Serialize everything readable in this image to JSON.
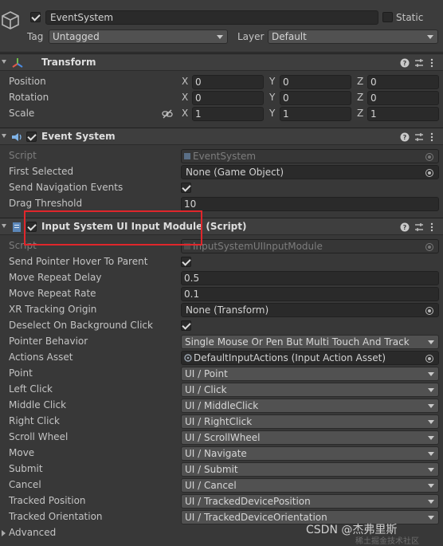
{
  "header": {
    "active": true,
    "name": "EventSystem",
    "static_label": "Static",
    "tag_label": "Tag",
    "tag_value": "Untagged",
    "layer_label": "Layer",
    "layer_value": "Default"
  },
  "transform": {
    "title": "Transform",
    "rows": [
      {
        "label": "Position",
        "x": "0",
        "y": "0",
        "z": "0"
      },
      {
        "label": "Rotation",
        "x": "0",
        "y": "0",
        "z": "0"
      },
      {
        "label": "Scale",
        "x": "1",
        "y": "1",
        "z": "1"
      }
    ],
    "axis_x": "X",
    "axis_y": "Y",
    "axis_z": "Z"
  },
  "event_system": {
    "title": "Event System",
    "enabled": true,
    "script_label": "Script",
    "script_value": "EventSystem",
    "first_selected_label": "First Selected",
    "first_selected_value": "None (Game Object)",
    "send_nav_label": "Send Navigation Events",
    "send_nav_checked": true,
    "drag_threshold_label": "Drag Threshold",
    "drag_threshold_value": "10"
  },
  "input_module": {
    "title": "Input System UI Input Module (Script)",
    "enabled": true,
    "script_label": "Script",
    "script_value": "InputSystemUIInputModule",
    "send_hover_label": "Send Pointer Hover To Parent",
    "move_delay_label": "Move Repeat Delay",
    "move_delay_value": "0.5",
    "move_rate_label": "Move Repeat Rate",
    "move_rate_value": "0.1",
    "xr_label": "XR Tracking Origin",
    "xr_value": "None (Transform)",
    "deselect_label": "Deselect On Background Click",
    "pointer_behavior_label": "Pointer Behavior",
    "pointer_behavior_value": "Single Mouse Or Pen But Multi Touch And Track",
    "actions_asset_label": "Actions Asset",
    "actions_asset_value": "DefaultInputActions (Input Action Asset)",
    "actions": [
      {
        "label": "Point",
        "value": "UI / Point"
      },
      {
        "label": "Left Click",
        "value": "UI / Click"
      },
      {
        "label": "Middle Click",
        "value": "UI / MiddleClick"
      },
      {
        "label": "Right Click",
        "value": "UI / RightClick"
      },
      {
        "label": "Scroll Wheel",
        "value": "UI / ScrollWheel"
      },
      {
        "label": "Move",
        "value": "UI / Navigate"
      },
      {
        "label": "Submit",
        "value": "UI / Submit"
      },
      {
        "label": "Cancel",
        "value": "UI / Cancel"
      },
      {
        "label": "Tracked Position",
        "value": "UI / TrackedDevicePosition"
      },
      {
        "label": "Tracked Orientation",
        "value": "UI / TrackedDeviceOrientation"
      }
    ],
    "advanced_label": "Advanced"
  },
  "watermark": "CSDN @杰弗里斯",
  "watermark_sub": "稀土掘金技术社区",
  "colors": {
    "highlight_box": "#e0262b",
    "panel_bg": "#383838",
    "header_bg": "#3e3e3e"
  }
}
